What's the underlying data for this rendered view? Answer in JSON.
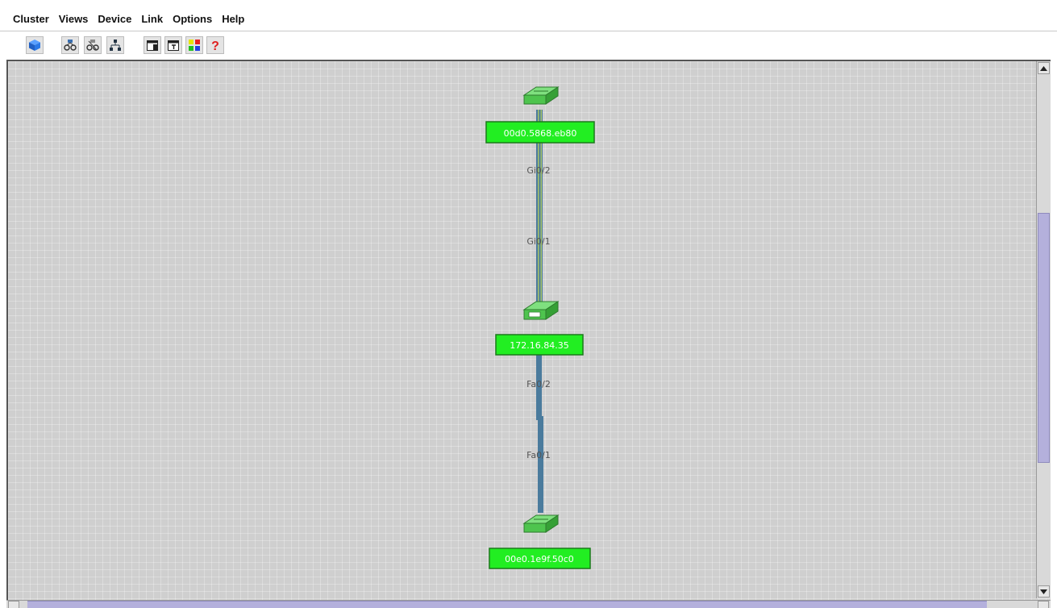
{
  "menubar": {
    "items": [
      {
        "label": "Cluster"
      },
      {
        "label": "Views"
      },
      {
        "label": "Device"
      },
      {
        "label": "Link"
      },
      {
        "label": "Options"
      },
      {
        "label": "Help"
      }
    ]
  },
  "toolbar": {
    "buttons": [
      {
        "icon": "cluster-cube-icon"
      },
      {
        "icon": "topology-view-icon"
      },
      {
        "icon": "topology-view-alt-icon"
      },
      {
        "icon": "network-tree-icon"
      },
      {
        "icon": "device-properties-icon"
      },
      {
        "icon": "link-properties-icon"
      },
      {
        "icon": "legend-colors-icon"
      },
      {
        "icon": "help-question-icon"
      }
    ]
  },
  "topology": {
    "nodes": [
      {
        "label": "00d0.5868.eb80",
        "icon": "switch-icon",
        "color": "#22ee22"
      },
      {
        "label": "172.16.84.35",
        "icon": "switch-icon",
        "color": "#22ee22"
      },
      {
        "label": "00e0.1e9f.50c0",
        "icon": "switch-icon",
        "color": "#22ee22"
      }
    ],
    "links": [
      {
        "from_port": "Gi0/2",
        "to_port": "Gi0/1",
        "style": "gigabit"
      },
      {
        "from_port": "Fa0/2",
        "to_port": "Fa0/1",
        "style": "fastethernet"
      }
    ]
  },
  "colors": {
    "canvas_background": "#cfcfcf",
    "node_label_background": "#22ee22",
    "link_fastethernet": "#4a7b9d",
    "link_gigabit_stripe": "#7a8f5a",
    "scrollbar_thumb": "#b4b0dc"
  }
}
